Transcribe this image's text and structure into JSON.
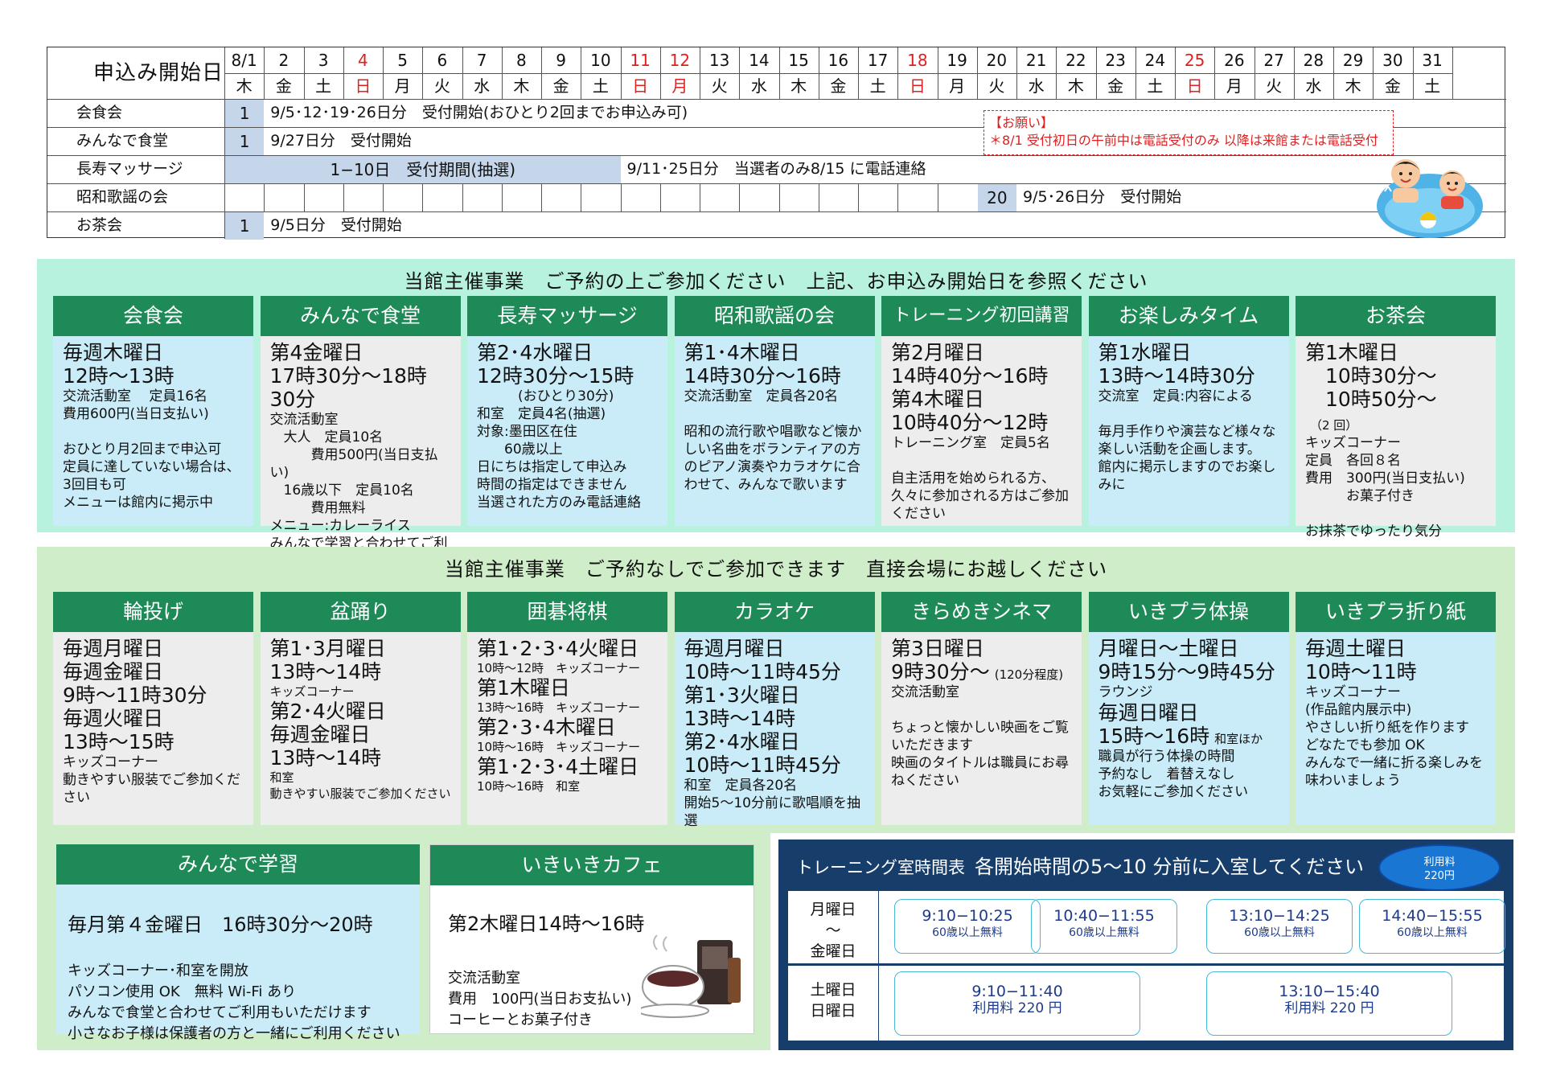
{
  "calendar": {
    "title": "申込み開始日",
    "days": [
      "8/1",
      "2",
      "3",
      "4",
      "5",
      "6",
      "7",
      "8",
      "9",
      "10",
      "11",
      "12",
      "13",
      "14",
      "15",
      "16",
      "17",
      "18",
      "19",
      "20",
      "21",
      "22",
      "23",
      "24",
      "25",
      "26",
      "27",
      "28",
      "29",
      "30",
      "31"
    ],
    "weekdays": [
      "木",
      "金",
      "土",
      "日",
      "月",
      "火",
      "水",
      "木",
      "金",
      "土",
      "日",
      "月",
      "火",
      "水",
      "木",
      "金",
      "土",
      "日",
      "月",
      "火",
      "水",
      "木",
      "金",
      "土",
      "日",
      "月",
      "火",
      "水",
      "木",
      "金",
      "土"
    ],
    "holiday_indices": [
      3,
      10,
      11,
      17,
      24
    ],
    "rows": [
      {
        "label": "会食会",
        "start": "1",
        "text": "9/5･12･19･26日分　受付開始(おひとり2回までお申込み可)"
      },
      {
        "label": "みんなで食堂",
        "start": "1",
        "text": "9/27日分　受付開始"
      },
      {
        "label": "長寿マッサージ",
        "start": "1−10日　受付期間(抽選)",
        "text": "9/11･25日分　当選者のみ8/15 に電話連絡"
      },
      {
        "label": "昭和歌謡の会",
        "start": "20",
        "text": "9/5･26日分　受付開始"
      },
      {
        "label": "お茶会",
        "start": "1",
        "text": "9/5日分　受付開始"
      }
    ],
    "notice_title": "【お願い】",
    "notice_text": "＊8/1  受付初日の午前中は電話受付のみ  以降は来館または電話受付"
  },
  "reserved": {
    "title": "当館主催事業　ご予約の上ご参加ください　上記、お申込み開始日を参照ください",
    "cards": [
      {
        "name": "会食会",
        "big": "毎週木曜日\n12時～13時",
        "body": "交流活動室　 定員16名\n費用600円(当日支払い)\n\nおひとり月2回まで申込可\n定員に達していない場合は、3回目も可\nメニューは館内に掲示中"
      },
      {
        "name": "みんなで食堂",
        "big": "第4金曜日\n17時30分～18時30分",
        "body": "交流活動室\n　大人　定員10名\n　　　費用500円(当日支払い)\n　16歳以下　定員10名\n　　　費用無料\nメニュー:カレーライス\nみんなで学習と合わせてご利用も可"
      },
      {
        "name": "長寿マッサージ",
        "big": "第2･4水曜日\n12時30分～15時",
        "body": "　　　(おひとり30分)\n和室　定員4名(抽選)\n対象:墨田区在住\n　　60歳以上\n日にちは指定して申込み\n時間の指定はできません\n当選された方のみ電話連絡"
      },
      {
        "name": "昭和歌謡の会",
        "big": "第1･4木曜日\n14時30分～16時",
        "body": "交流活動室　定員各20名\n\n昭和の流行歌や唱歌など懐かしい名曲をボランティアの方のピアノ演奏やカラオケに合わせて、みんなで歌います"
      },
      {
        "name": "トレーニング初回講習",
        "big": "第2月曜日\n14時40分～16時\n第4木曜日\n10時40分～12時",
        "body": "トレーニング室　定員5名\n\n自主活用を始められる方、久々に参加される方はご参加ください"
      },
      {
        "name": "お楽しみタイム",
        "big": "第1水曜日\n13時～14時30分",
        "body": "交流室　定員:内容による\n\n毎月手作りや演芸など様々な楽しい活動を企画します。\n館内に掲示しますのでお楽しみに"
      },
      {
        "name": "お茶会",
        "big": "第1木曜日\n　10時30分～\n　10時50分～",
        "extra": "（2 回）",
        "body": "キッズコーナー\n定員　各回８名\n費用　300円(当日支払い)\n　　　お菓子付き\n\nお抹茶でゆったり気分"
      }
    ]
  },
  "walkin": {
    "title": "当館主催事業　ご予約なしでご参加できます　直接会場にお越しください",
    "cards": [
      {
        "name": "輪投げ",
        "big": "毎週月曜日\n毎週金曜日\n9時～11時30分\n毎週火曜日\n13時～15時",
        "body": "キッズコーナー\n動きやすい服装でご参加ください"
      },
      {
        "name": "盆踊り",
        "big": "第1･3月曜日\n13時～14時",
        "body": "キッズコーナー",
        "big2": "第2･4火曜日\n毎週金曜日\n13時～14時",
        "body2": "和室\n動きやすい服装でご参加ください"
      },
      {
        "name": "囲碁将棋",
        "big": "第1･2･3･4火曜日",
        "body": "10時～12時　キッズコーナー",
        "big2": "第1木曜日",
        "body2": "13時～16時　キッズコーナー",
        "big3": "第2･3･4木曜日",
        "body3": "10時～16時　キッズコーナー",
        "big4": "第1･2･3･4土曜日",
        "body4": "10時～16時　和室"
      },
      {
        "name": "カラオケ",
        "big": "毎週月曜日\n10時～11時45分\n第1･3火曜日\n13時～14時\n第2･4水曜日\n10時～11時45分",
        "body": "和室　定員各20名\n開始5～10分前に歌唱順を抽選"
      },
      {
        "name": "きらめきシネマ",
        "big": "第3日曜日\n9時30分～",
        "extra": "(120分程度)",
        "body": "交流活動室\n\nちょっと懐かしい映画をご覧いただきます\n映画のタイトルは職員にお尋ねください"
      },
      {
        "name": "いきプラ体操",
        "big": "月曜日～土曜日\n9時15分～9時45分",
        "body": "ラウンジ",
        "big2": "毎週日曜日\n15時～16時",
        "extra": "和室ほか",
        "body2": "職員が行う体操の時間\n予約なし　着替えなし\nお気軽にご参加ください"
      },
      {
        "name": "いきプラ折り紙",
        "big": "毎週土曜日\n10時～11時",
        "body": "キッズコーナー\n(作品館内展示中)\nやさしい折り紙を作ります\nどなたでも参加 OK\nみんなで一緒に折る楽しみを味わいましょう"
      }
    ]
  },
  "study": {
    "name": "みんなで学習",
    "big": "毎月第４金曜日　16時30分～20時",
    "body": "キッズコーナー･和室を開放\nパソコン使用 OK　無料 Wi-Fi あり\nみんなで食堂と合わせてご利用もいただけます\n小さなお子様は保護者の方と一緒にご利用ください"
  },
  "cafe": {
    "name": "いきいきカフェ",
    "big": "第2木曜日14時～16時",
    "body": "交流活動室\n費用　100円(当日お支払い)\nコーヒーとお菓子付き"
  },
  "training": {
    "title": "トレーニング室時間表",
    "subtitle": "各開始時間の5～10 分前に入室してください",
    "fee": "利用料\n220円",
    "weekday_label": "月曜日\n～\n金曜日",
    "weekend_label": "土曜日\n日曜日",
    "weekday_slots": [
      {
        "time": "9:10−10:25",
        "note": "60歳以上無料"
      },
      {
        "time": "10:40−11:55",
        "note": "60歳以上無料"
      },
      {
        "time": "13:10−14:25",
        "note": "60歳以上無料"
      },
      {
        "time": "14:40−15:55",
        "note": "60歳以上無料"
      }
    ],
    "weekend_slots": [
      {
        "time": "9:10−11:40",
        "note": "利用料 220 円"
      },
      {
        "time": "13:10−15:40",
        "note": "利用料 220 円"
      }
    ]
  },
  "colors": {
    "header_green": "#1e8a58",
    "band1": "#b6f2de",
    "band2": "#cfedc8",
    "card_blue": "#c9ecf8",
    "card_gray": "#ededed",
    "training_navy": "#173e6b",
    "holiday_red": "#e02020"
  }
}
